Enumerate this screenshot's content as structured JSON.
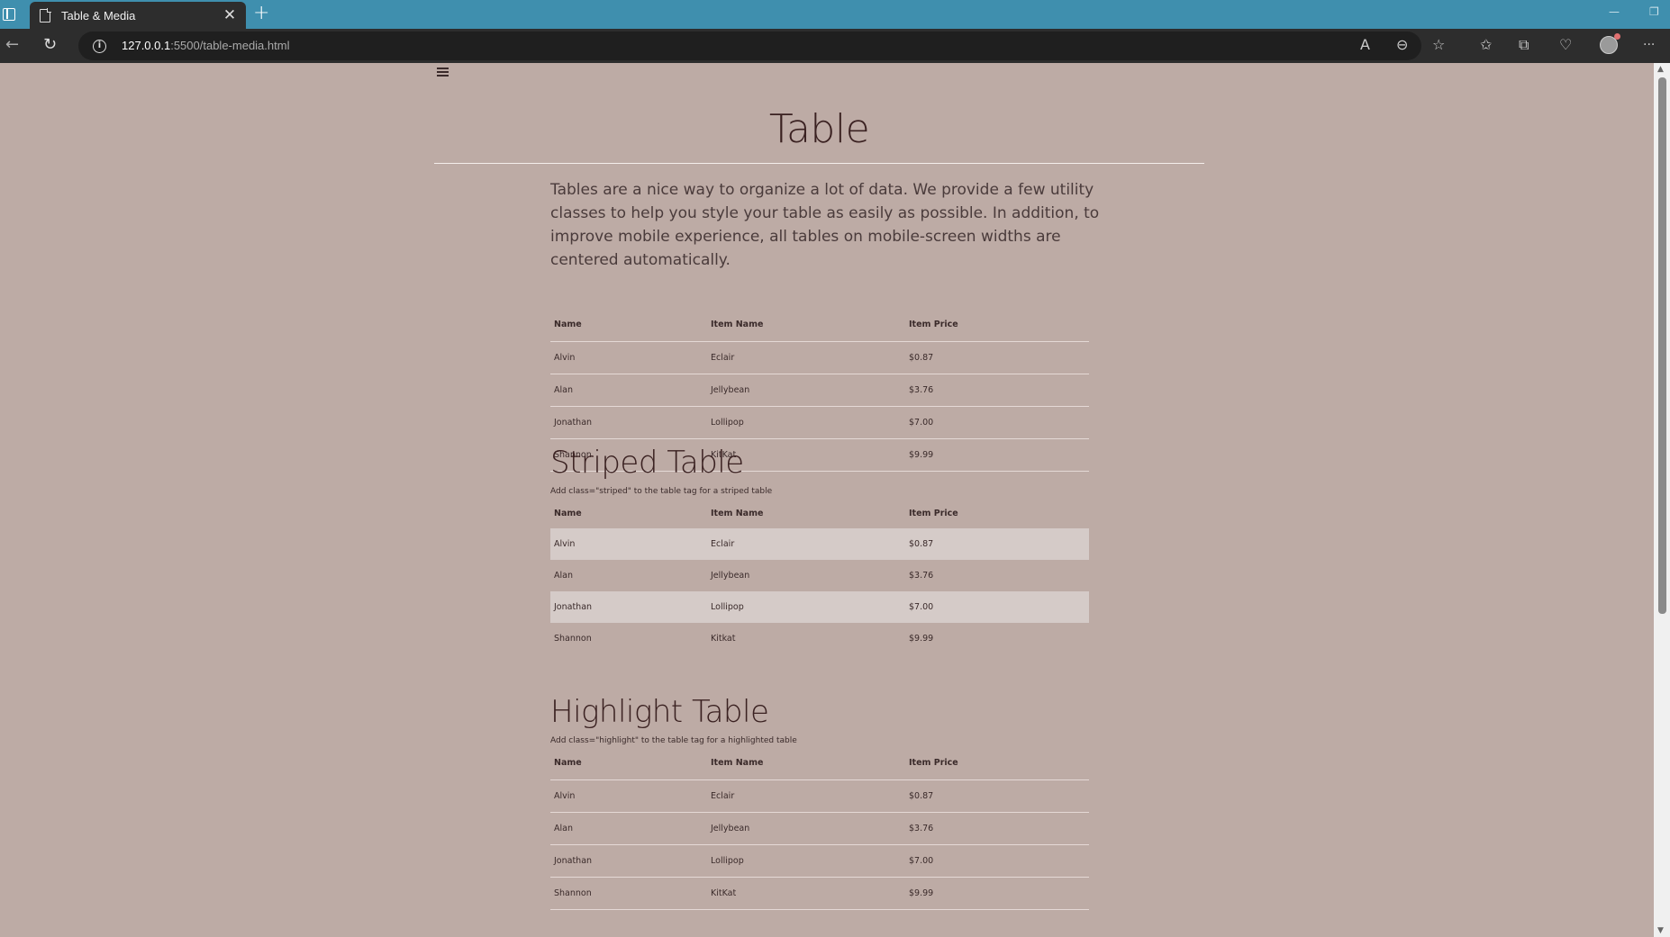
{
  "browser": {
    "tab_title": "Table & Media",
    "url_host": "127.0.0.1",
    "url_rest": ":5500/table-media.html"
  },
  "page": {
    "title": "Table",
    "intro": "Tables are a nice way to organize a lot of data. We provide a few utility classes to help you style your table as easily as possible. In addition, to improve mobile experience, all tables on mobile-screen widths are centered automatically.",
    "headers": [
      "Name",
      "Item Name",
      "Item Price"
    ],
    "table1": [
      [
        "Alvin",
        "Eclair",
        "$0.87"
      ],
      [
        "Alan",
        "Jellybean",
        "$3.76"
      ],
      [
        "Jonathan",
        "Lollipop",
        "$7.00"
      ],
      [
        "Shannon",
        "KitKat",
        "$9.99"
      ]
    ],
    "striped": {
      "heading": "Striped Table",
      "note": "Add class=\"striped\" to the table tag for a striped table",
      "rows": [
        [
          "Alvin",
          "Eclair",
          "$0.87"
        ],
        [
          "Alan",
          "Jellybean",
          "$3.76"
        ],
        [
          "Jonathan",
          "Lollipop",
          "$7.00"
        ],
        [
          "Shannon",
          "Kitkat",
          "$9.99"
        ]
      ]
    },
    "highlight": {
      "heading": "Highlight Table",
      "note": "Add class=\"highlight\" to the table tag for a highlighted table",
      "rows": [
        [
          "Alvin",
          "Eclair",
          "$0.87"
        ],
        [
          "Alan",
          "Jellybean",
          "$3.76"
        ],
        [
          "Jonathan",
          "Lollipop",
          "$7.00"
        ],
        [
          "Shannon",
          "KitKat",
          "$9.99"
        ]
      ]
    }
  }
}
